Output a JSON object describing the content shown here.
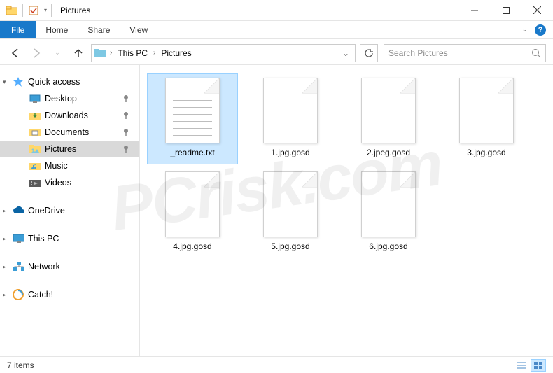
{
  "window": {
    "title": "Pictures"
  },
  "ribbon": {
    "file": "File",
    "tabs": [
      "Home",
      "Share",
      "View"
    ]
  },
  "breadcrumb": {
    "items": [
      "This PC",
      "Pictures"
    ]
  },
  "search": {
    "placeholder": "Search Pictures"
  },
  "sidebar": {
    "quickaccess": {
      "label": "Quick access",
      "items": [
        {
          "label": "Desktop",
          "pinned": true
        },
        {
          "label": "Downloads",
          "pinned": true
        },
        {
          "label": "Documents",
          "pinned": true
        },
        {
          "label": "Pictures",
          "pinned": true,
          "selected": true
        },
        {
          "label": "Music",
          "pinned": false
        },
        {
          "label": "Videos",
          "pinned": false
        }
      ]
    },
    "roots": [
      {
        "label": "OneDrive",
        "kind": "onedrive"
      },
      {
        "label": "This PC",
        "kind": "pc"
      },
      {
        "label": "Network",
        "kind": "network"
      },
      {
        "label": "Catch!",
        "kind": "catch"
      }
    ]
  },
  "files": [
    {
      "name": "_readme.txt",
      "type": "text",
      "selected": true
    },
    {
      "name": "1.jpg.gosd",
      "type": "blank"
    },
    {
      "name": "2.jpeg.gosd",
      "type": "blank"
    },
    {
      "name": "3.jpg.gosd",
      "type": "blank"
    },
    {
      "name": "4.jpg.gosd",
      "type": "blank"
    },
    {
      "name": "5.jpg.gosd",
      "type": "blank"
    },
    {
      "name": "6.jpg.gosd",
      "type": "blank"
    }
  ],
  "status": {
    "count_label": "7 items"
  },
  "watermark": "PCrisk.com"
}
